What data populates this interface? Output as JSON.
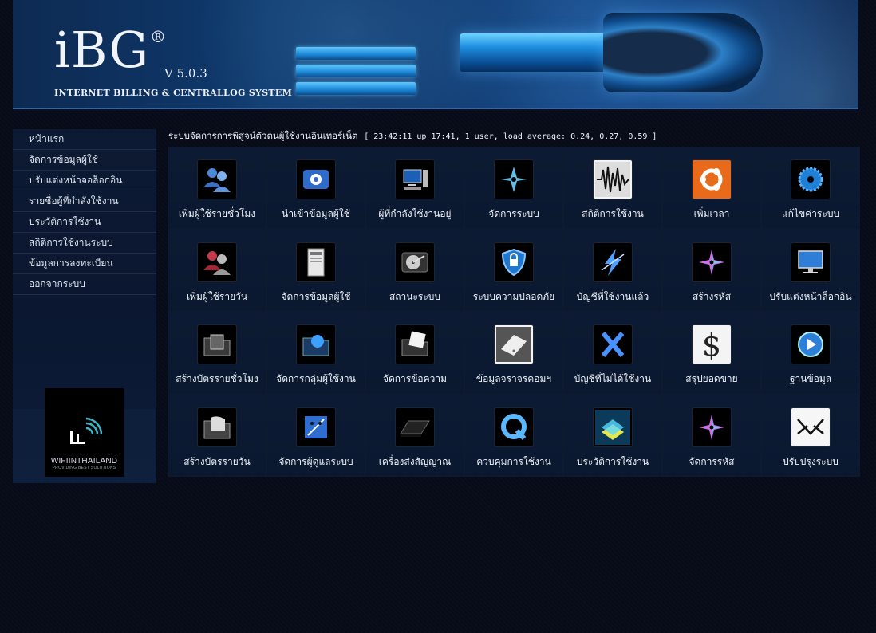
{
  "banner": {
    "logo": "iBG",
    "registered": "®",
    "version": "V 5.0.3",
    "tagline": "INTERNET BILLING & CENTRALLOG SYSTEM"
  },
  "sidebar": {
    "items": [
      {
        "label": "หน้าแรก"
      },
      {
        "label": "จัดการข้อมูลผู้ใช้"
      },
      {
        "label": "ปรับแต่งหน้าจอล็อกอิน"
      },
      {
        "label": "รายชื่อผู้ที่กำลังใช้งาน"
      },
      {
        "label": "ประวัติการใช้งาน"
      },
      {
        "label": "สถิติการใช้งานระบบ"
      },
      {
        "label": "ข้อมูลการลงทะเบียน"
      },
      {
        "label": "ออกจากระบบ"
      }
    ],
    "partner_logo": {
      "name": "WIFIINTHAILAND",
      "sub": "PROVIDING BEST SOLUTIONS"
    }
  },
  "status": {
    "title": "ระบบจัดการการพิสูจน์ตัวตนผู้ใช้งานอินเทอร์เน็ต",
    "uptime": "[ 23:42:11 up 17:41, 1 user, load average: 0.24, 0.27, 0.59 ]"
  },
  "grid": {
    "cells": [
      {
        "label": "เพิ่มผู้ใช้รายชั่วโมง",
        "icon": "users-icon"
      },
      {
        "label": "นำเข้าข้อมูลผู้ใช้",
        "icon": "import-icon"
      },
      {
        "label": "ผู้ที่กำลังใช้งานอยู่",
        "icon": "computer-icon"
      },
      {
        "label": "จัดการระบบ",
        "icon": "system-star-icon"
      },
      {
        "label": "สถิติการใช้งาน",
        "icon": "waveform-icon"
      },
      {
        "label": "เพิ่มเวลา",
        "icon": "ubuntu-icon"
      },
      {
        "label": "แก้ไขค่าระบบ",
        "icon": "saw-blade-icon"
      },
      {
        "label": "เพิ่มผู้ใช้รายวัน",
        "icon": "users-red-icon"
      },
      {
        "label": "จัดการข้อมูลผู้ใช้",
        "icon": "server-tower-icon"
      },
      {
        "label": "สถานะระบบ",
        "icon": "hard-disk-icon"
      },
      {
        "label": "ระบบความปลอดภัย",
        "icon": "shield-icon"
      },
      {
        "label": "บัญชีที่ใช้งานแล้ว",
        "icon": "bolt-icon"
      },
      {
        "label": "สร้างรหัส",
        "icon": "star-icon"
      },
      {
        "label": "ปรับแต่งหน้าล็อกอิน",
        "icon": "monitor-icon"
      },
      {
        "label": "สร้างบัตรรายชั่วโมง",
        "icon": "film-folder-icon"
      },
      {
        "label": "จัดการกลุ่มผู้ใช้งาน",
        "icon": "globe-folder-icon"
      },
      {
        "label": "จัดการข้อความ",
        "icon": "document-folder-icon"
      },
      {
        "label": "ข้อมูลจราจรคอมฯ",
        "icon": "drive-icon"
      },
      {
        "label": "บัญชีที่ไม่ได้ใช้งาน",
        "icon": "x-icon"
      },
      {
        "label": "สรุปยอดขาย",
        "icon": "dollar-icon"
      },
      {
        "label": "ฐานข้อมูล",
        "icon": "play-icon"
      },
      {
        "label": "สร้างบัตรรายวัน",
        "icon": "folder-icon"
      },
      {
        "label": "จัดการผู้ดูแลระบบ",
        "icon": "finder-icon"
      },
      {
        "label": "เครื่องส่งสัญญาณ",
        "icon": "router-icon"
      },
      {
        "label": "ควบคุมการใช้งาน",
        "icon": "quicktime-icon"
      },
      {
        "label": "ประวัติการใช้งาน",
        "icon": "stack-icon"
      },
      {
        "label": "จัดการรหัส",
        "icon": "star-icon"
      },
      {
        "label": "ปรับปรุงระบบ",
        "icon": "envelope-logo-icon"
      }
    ]
  },
  "colors": {
    "background": "#070b18",
    "banner": "#0f3a6e",
    "sidebar": "#0d1a33",
    "cell": "#0c1b33"
  }
}
